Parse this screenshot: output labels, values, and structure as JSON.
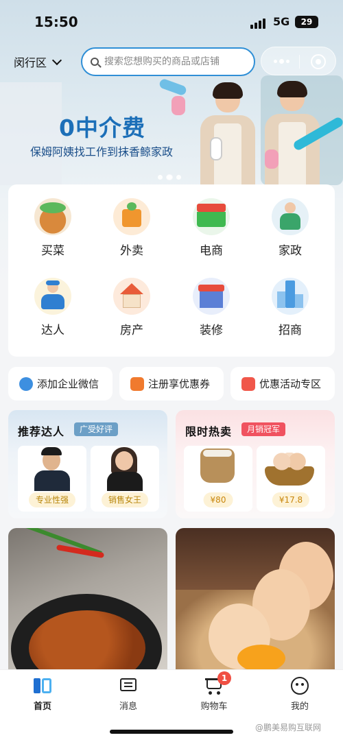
{
  "status_bar": {
    "time": "15:50",
    "network": "5G",
    "battery": "29"
  },
  "topbar": {
    "district": "闵行区",
    "search_placeholder": "搜索您想购买的商品或店铺"
  },
  "banner": {
    "headline": "0中介费",
    "subtitle": "保姆阿姨找工作到抹香鲸家政",
    "page_count": 3,
    "active_page": 2
  },
  "services": [
    {
      "label": "买菜",
      "icon": "vegetable-basket-icon"
    },
    {
      "label": "外卖",
      "icon": "takeout-box-icon"
    },
    {
      "label": "电商",
      "icon": "market-store-icon"
    },
    {
      "label": "家政",
      "icon": "housekeeper-icon"
    },
    {
      "label": "达人",
      "icon": "expert-person-icon"
    },
    {
      "label": "房产",
      "icon": "house-icon"
    },
    {
      "label": "装修",
      "icon": "renovation-shop-icon"
    },
    {
      "label": "招商",
      "icon": "business-building-icon"
    }
  ],
  "quick_links": [
    {
      "label": "添加企业微信",
      "icon": "wechat-work-icon"
    },
    {
      "label": "注册享优惠券",
      "icon": "coupon-icon"
    },
    {
      "label": "优惠活动专区",
      "icon": "gift-icon"
    }
  ],
  "recommend": {
    "title": "推荐达人",
    "tag": "广受好评",
    "people": [
      {
        "chip": "专业性强"
      },
      {
        "chip": "销售女王"
      }
    ]
  },
  "hot_sale": {
    "title": "限时热卖",
    "tag": "月销冠军",
    "items": [
      {
        "price": "¥80"
      },
      {
        "price": "¥17.8"
      }
    ]
  },
  "tabs": [
    {
      "label": "首页",
      "icon": "home-logo-icon",
      "active": true
    },
    {
      "label": "消息",
      "icon": "message-icon",
      "active": false
    },
    {
      "label": "购物车",
      "icon": "cart-icon",
      "active": false,
      "badge": "1"
    },
    {
      "label": "我的",
      "icon": "profile-icon",
      "active": false
    }
  ],
  "watermark": "@鹏美易购互联网"
}
